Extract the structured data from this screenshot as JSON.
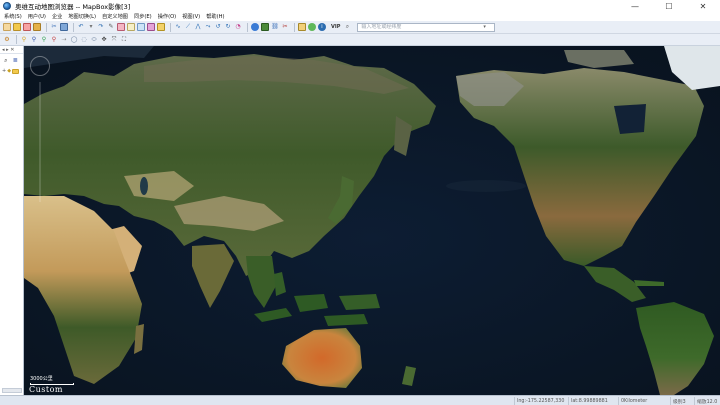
{
  "window": {
    "title": "奥维互动地图浏览器 -- MapBox影像[3]",
    "controls": {
      "minimize": "—",
      "maximize": "☐",
      "close": "✕"
    }
  },
  "menu": {
    "items": [
      "系统(S)",
      "用户(U)",
      "企业",
      "地图切换(L)",
      "自定义地图",
      "同步(E)",
      "操作(O)",
      "视图(V)",
      "帮助(H)"
    ]
  },
  "toolbar": {
    "search_placeholder": "输入地址或经纬度",
    "vip_label": "VIP"
  },
  "left_panel": {
    "header": "◂ ▸ ✕"
  },
  "map": {
    "scale_label": "3000公里",
    "layer_label": "Custom"
  },
  "status": {
    "coords": "lng:-175.22587,330",
    "grid": "lat:8.99889881",
    "measure": "0Kilometer",
    "level": "级别3",
    "zoom": "缩放12.0"
  },
  "colors": {
    "ocean": "#0c1a2c",
    "land_green": "#3e5a2c",
    "land_desert": "#c9a56a",
    "land_australia": "#c96a2e",
    "ice": "#e8eef2",
    "toolbar_bg": "#e9eef6",
    "status_bg": "#dfe6f0"
  }
}
